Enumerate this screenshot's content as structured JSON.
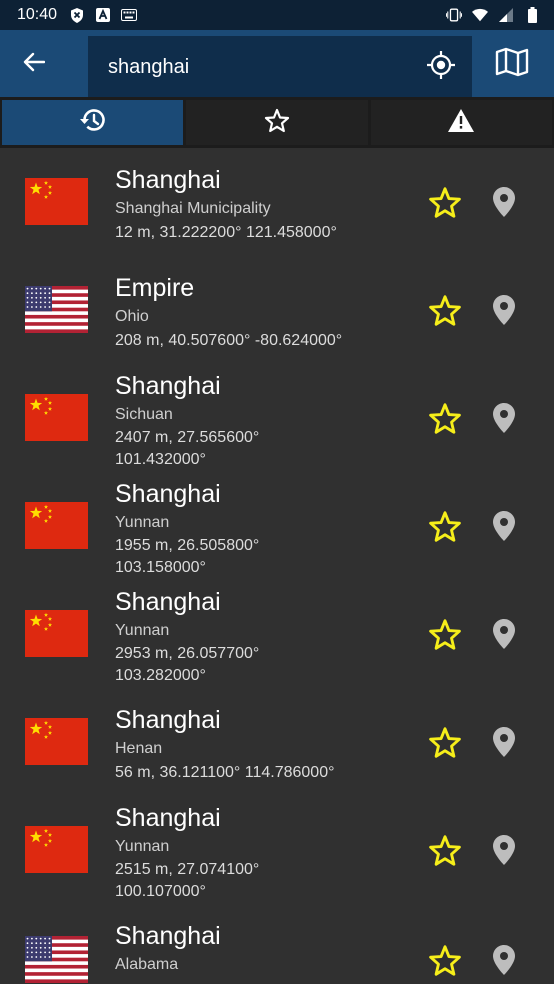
{
  "status_bar": {
    "time": "10:40",
    "icons": [
      "shield-x-icon",
      "a-box-icon",
      "keyboard-icon",
      "vibrate-icon",
      "wifi-icon",
      "signal-icon",
      "battery-icon"
    ]
  },
  "app_bar": {
    "back_icon": "arrow-left-icon",
    "search": {
      "value": "shanghai",
      "placeholder": ""
    },
    "locate_icon": "crosshair-icon",
    "map_icon": "map-icon"
  },
  "tabs": [
    {
      "icon": "history-icon",
      "active": true
    },
    {
      "icon": "star-outline-icon",
      "active": false
    },
    {
      "icon": "warning-icon",
      "active": false
    }
  ],
  "colors": {
    "accent": "#1b4a76",
    "statusbar": "#0d2135",
    "background": "#303030",
    "favorite": "#f6ee1a"
  },
  "results": [
    {
      "flag": "cn",
      "title": "Shanghai",
      "subtitle": "Shanghai Municipality",
      "coords": "12 m, 31.222200° 121.458000°"
    },
    {
      "flag": "us",
      "title": "Empire",
      "subtitle": "Ohio",
      "coords": "208 m, 40.507600° -80.624000°"
    },
    {
      "flag": "cn",
      "title": "Shanghai",
      "subtitle": "Sichuan",
      "coords": "2407 m, 27.565600° 101.432000°"
    },
    {
      "flag": "cn",
      "title": "Shanghai",
      "subtitle": "Yunnan",
      "coords": "1955 m, 26.505800° 103.158000°"
    },
    {
      "flag": "cn",
      "title": "Shanghai",
      "subtitle": "Yunnan",
      "coords": "2953 m, 26.057700° 103.282000°"
    },
    {
      "flag": "cn",
      "title": "Shanghai",
      "subtitle": "Henan",
      "coords": "56 m, 36.121100° 114.786000°"
    },
    {
      "flag": "cn",
      "title": "Shanghai",
      "subtitle": "Yunnan",
      "coords": "2515 m, 27.074100° 100.107000°"
    },
    {
      "flag": "us",
      "title": "Shanghai",
      "subtitle": "Alabama",
      "coords": ""
    }
  ]
}
